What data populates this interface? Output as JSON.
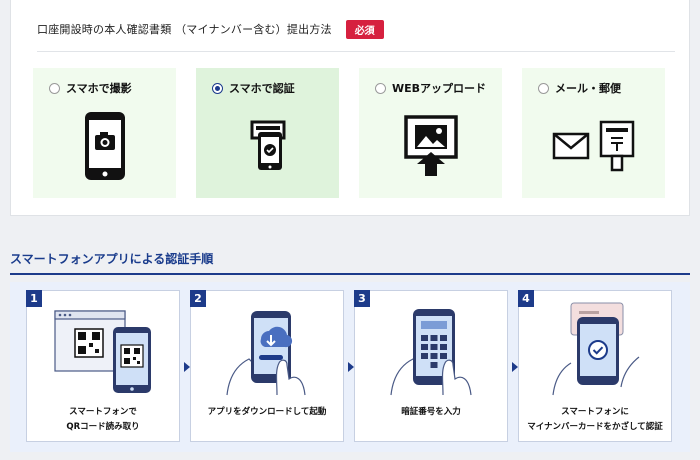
{
  "question": {
    "label": "口座開設時の本人確認書類 （マイナンバー含む）提出方法",
    "badge": "必須"
  },
  "options": [
    {
      "label": "スマホで撮影",
      "selected": false,
      "icon": "phone-camera-icon"
    },
    {
      "label": "スマホで認証",
      "selected": true,
      "icon": "phone-card-verify-icon"
    },
    {
      "label": "WEBアップロード",
      "selected": false,
      "icon": "web-upload-icon"
    },
    {
      "label": "メール・郵便",
      "selected": false,
      "icon": "mail-postbox-icon"
    }
  ],
  "steps_section": {
    "title": "スマートフォンアプリによる認証手順",
    "steps": [
      {
        "number": "1",
        "caption_line1": "スマートフォンで",
        "caption_line2": "QRコード読み取り",
        "illustration": "qr-scan-illustration"
      },
      {
        "number": "2",
        "caption_line1": "アプリをダウンロードして起動",
        "caption_line2": "",
        "illustration": "app-download-illustration"
      },
      {
        "number": "3",
        "caption_line1": "暗証番号を入力",
        "caption_line2": "",
        "illustration": "pin-entry-illustration"
      },
      {
        "number": "4",
        "caption_line1": "スマートフォンに",
        "caption_line2": "マイナンバーカードをかざして認証",
        "illustration": "card-tap-illustration"
      }
    ]
  },
  "colors": {
    "accent_navy": "#1d3b8a",
    "required_red": "#d6203f",
    "option_bg": "#f1fbee",
    "option_selected_bg": "#dff3dc",
    "steps_bg": "#eaf0fb"
  }
}
